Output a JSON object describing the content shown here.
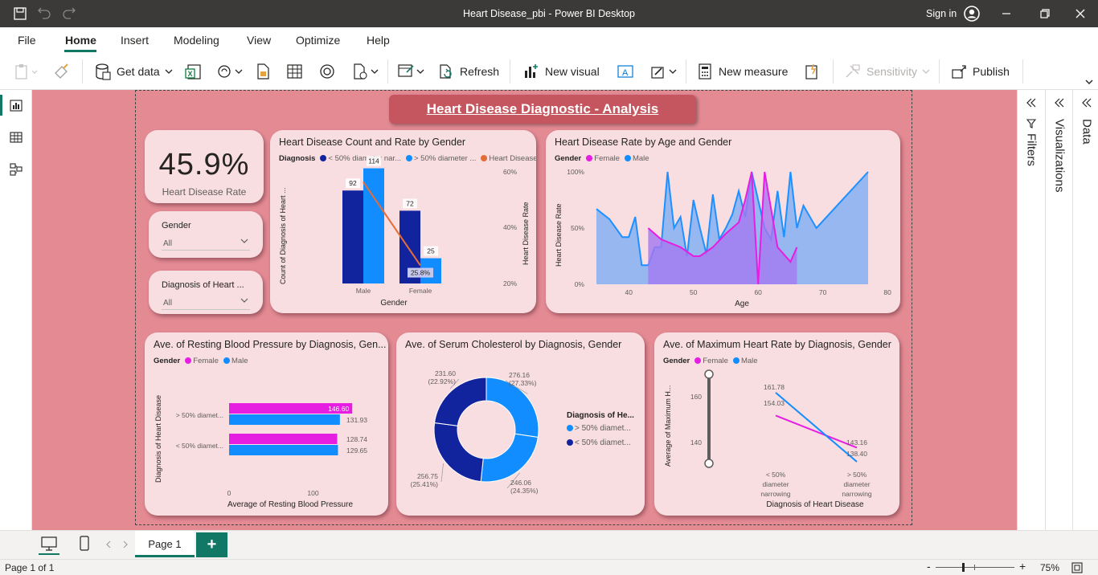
{
  "window": {
    "title": "Heart Disease_pbi - Power BI Desktop",
    "signin": "Sign in"
  },
  "menu": {
    "file": "File",
    "home": "Home",
    "insert": "Insert",
    "modeling": "Modeling",
    "view": "View",
    "optimize": "Optimize",
    "help": "Help"
  },
  "ribbon": {
    "get_data": "Get data",
    "refresh": "Refresh",
    "new_visual": "New visual",
    "new_measure": "New measure",
    "sensitivity": "Sensitivity",
    "publish": "Publish"
  },
  "panes": {
    "filters": "Filters",
    "visualizations": "Visualizations",
    "data": "Data"
  },
  "report": {
    "title": "Heart Disease Diagnostic - Analysis"
  },
  "kpi": {
    "value": "45.9%",
    "label": "Heart Disease Rate"
  },
  "slicers": [
    {
      "label": "Gender",
      "value": "All"
    },
    {
      "label": "Diagnosis of Heart ...",
      "value": "All"
    }
  ],
  "charts": {
    "count_rate": {
      "title": "Heart Disease Count and Rate by Gender",
      "legend_title": "Diagnosis",
      "legend": [
        "< 50% diameter nar...",
        "> 50% diameter ...",
        "Heart Disease ..."
      ],
      "y_label": "Count of Diagnosis of Heart ...",
      "y2_label": "Heart Disease Rate",
      "x_label": "Gender",
      "y2_ticks": [
        "60%",
        "40%",
        "20%"
      ]
    },
    "age_rate": {
      "title": "Heart Disease Rate by Age and Gender",
      "legend_title": "Gender",
      "legend": [
        "Female",
        "Male"
      ],
      "y_label": "Heart Disease Rate",
      "x_label": "Age",
      "y_ticks": [
        "100%",
        "50%",
        "0%"
      ]
    },
    "bp": {
      "title": "Ave. of Resting Blood Pressure by Diagnosis, Gen...",
      "legend_title": "Gender",
      "legend": [
        "Female",
        "Male"
      ],
      "y_label": "Diagnosis of Heart Disease",
      "x_label": "Average of Resting Blood Pressure"
    },
    "chol": {
      "title": "Ave. of Serum Cholesterol by Diagnosis, Gender",
      "legend_title": "Diagnosis of He...",
      "legend": [
        "> 50% diamet...",
        "< 50% diamet..."
      ]
    },
    "hr": {
      "title": "Ave. of Maximum Heart Rate by Diagnosis, Gender",
      "legend_title": "Gender",
      "legend": [
        "Female",
        "Male"
      ],
      "y_label": "Average of Maximum H...",
      "x_label": "Diagnosis of Heart Disease"
    }
  },
  "tabs": {
    "page1": "Page 1",
    "add": "+"
  },
  "status": {
    "page": "Page 1 of 1",
    "zoom": "75%"
  },
  "colors": {
    "canvas": "#e38a93",
    "card": "#f8dde1",
    "navy": "#12239e",
    "blue": "#118dff",
    "magenta": "#e61ee1",
    "orange": "#e66c37",
    "teal": "#117865"
  },
  "chart_data": [
    {
      "type": "bar",
      "title": "Heart Disease Count and Rate by Gender",
      "categories": [
        "Male",
        "Female"
      ],
      "series": [
        {
          "name": "< 50% diameter nar...",
          "values": [
            92,
            72
          ]
        },
        {
          "name": "> 50% diameter ...",
          "values": [
            114,
            25
          ]
        },
        {
          "name": "Heart Disease ...",
          "values": [
            55.3,
            25.8
          ]
        }
      ],
      "data_labels": [
        "92",
        "114",
        "72",
        "25",
        "25.8%"
      ],
      "xlabel": "Gender",
      "ylabel": "Count of Diagnosis of Heart ...",
      "y2label": "Heart Disease Rate",
      "y2lim": [
        20,
        60
      ]
    },
    {
      "type": "area",
      "title": "Heart Disease Rate by Age and Gender",
      "x_ticks": [
        "40",
        "50",
        "60",
        "70",
        "80"
      ],
      "y_ticks": [
        "100%",
        "50%",
        "0%"
      ],
      "series": [
        {
          "name": "Male",
          "x": [
            35,
            37,
            38,
            39,
            40,
            41,
            42,
            43,
            44,
            45,
            46,
            47,
            48,
            49,
            50,
            51,
            52,
            53,
            54,
            55,
            56,
            57,
            58,
            59,
            60,
            61,
            62,
            63,
            64,
            65,
            66,
            67,
            69,
            77
          ],
          "y": [
            67,
            58,
            50,
            42,
            42,
            60,
            17,
            17,
            33,
            33,
            100,
            50,
            60,
            25,
            75,
            50,
            27,
            80,
            40,
            50,
            62,
            83,
            60,
            100,
            75,
            50,
            40,
            83,
            42,
            100,
            50,
            70,
            50,
            100
          ]
        },
        {
          "name": "Female",
          "x": [
            43,
            45,
            48,
            50,
            51,
            53,
            55,
            57,
            58,
            59,
            60,
            61,
            62,
            63,
            65,
            66
          ],
          "y": [
            50,
            40,
            33,
            25,
            25,
            33,
            45,
            55,
            75,
            100,
            0,
            100,
            67,
            33,
            20,
            33
          ]
        }
      ],
      "xlabel": "Age",
      "ylabel": "Heart Disease Rate",
      "xlim": [
        35,
        80
      ],
      "ylim": [
        0,
        100
      ]
    },
    {
      "type": "bar",
      "title": "Ave. of Resting Blood Pressure by Diagnosis, Gen...",
      "categories": [
        "> 50% diamet...",
        "< 50% diamet..."
      ],
      "series": [
        {
          "name": "Female",
          "values": [
            146.6,
            128.74
          ]
        },
        {
          "name": "Male",
          "values": [
            131.93,
            129.65
          ]
        }
      ],
      "x_ticks": [
        "0",
        "100"
      ],
      "xlabel": "Average of Resting Blood Pressure",
      "ylabel": "Diagnosis of Heart Disease"
    },
    {
      "type": "pie",
      "title": "Ave. of Serum Cholesterol by Diagnosis, Gender",
      "slices": [
        {
          "label": "276.16",
          "pct": "(27.33%)",
          "value": 276.16,
          "color": "#118dff"
        },
        {
          "label": "246.06",
          "pct": "(24.35%)",
          "value": 246.06,
          "color": "#118dff"
        },
        {
          "label": "256.75",
          "pct": "(25.41%)",
          "value": 256.75,
          "color": "#12239e"
        },
        {
          "label": "231.60",
          "pct": "(22.92%)",
          "value": 231.6,
          "color": "#12239e"
        }
      ]
    },
    {
      "type": "line",
      "title": "Ave. of Maximum Heart Rate by Diagnosis, Gender",
      "categories": [
        "< 50% diameter narrowing",
        "> 50% diameter narrowing"
      ],
      "category_lines": [
        [
          "< 50%",
          "diameter",
          "narrowing"
        ],
        [
          "> 50%",
          "diameter",
          "narrowing"
        ]
      ],
      "series": [
        {
          "name": "Female",
          "values": [
            154.03,
            143.16
          ],
          "labels": [
            "154.03",
            "143.16"
          ]
        },
        {
          "name": "Male",
          "values": [
            161.78,
            138.4
          ],
          "labels": [
            "161.78",
            "138.40"
          ]
        }
      ],
      "y_ticks": [
        "160",
        "140"
      ],
      "xlabel": "Diagnosis of Heart Disease",
      "ylabel": "Average of Maximum H...",
      "ylim": [
        127,
        168
      ]
    }
  ]
}
